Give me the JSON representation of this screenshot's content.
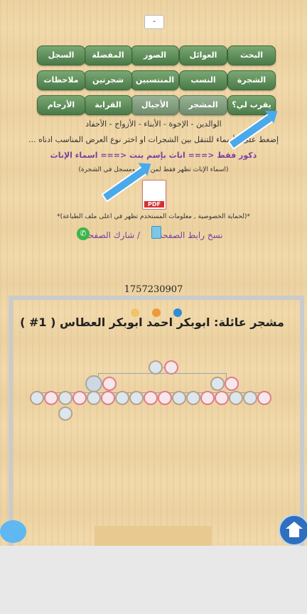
{
  "top_button": "-",
  "menu": {
    "row1": [
      "البحث",
      "العوائل",
      "الصور",
      "المفضلة",
      "السجل"
    ],
    "row2": [
      "الشجرة",
      "النسب",
      "المنتسبين",
      "شجرتين",
      "ملاحظات"
    ],
    "row3": [
      "يقرب لي؟",
      "المشجر",
      "الأجيال",
      "القرابة",
      "الأرحام"
    ]
  },
  "info_line": "الوالدين - الإخوة - الأبناء - الأزواج - الأحفاد",
  "instruction": "إضغط على الأسماء للتنقل بين الشجرات او اختر نوع العرض المناسب ادناه ...",
  "view_links": {
    "males_only": "ذكور فقط",
    "arrow_sep": "<===",
    "female_by_name": "اناث بإسم بنت",
    "arrow_sep2": "<===",
    "female_names": "اسماء الإناث"
  },
  "female_note": "(اسماء الإناث تظهر فقط لمن اسم ومسجل في الشجرة)",
  "pdf_label": "PDF",
  "privacy_note": "*(لحماية الخصوصية , معلومات المستخدم تظهر في اعلى ملف الطباعة)*",
  "share": {
    "copy_link": "نسخ رابط الصفحة",
    "separator": "/",
    "share_page": "شارك الصفحة"
  },
  "counter": "1757230907",
  "tree_title": "مشجر عائلة: ابوبكر احمد ابوبكر العطاس ( 1# )",
  "colors": {
    "menu_green": "#4a7a48",
    "link_purple": "#7b3fa0",
    "dot_yellow": "#f2c36b",
    "dot_orange": "#ee9a3a",
    "dot_blue": "#2d8fd6"
  }
}
